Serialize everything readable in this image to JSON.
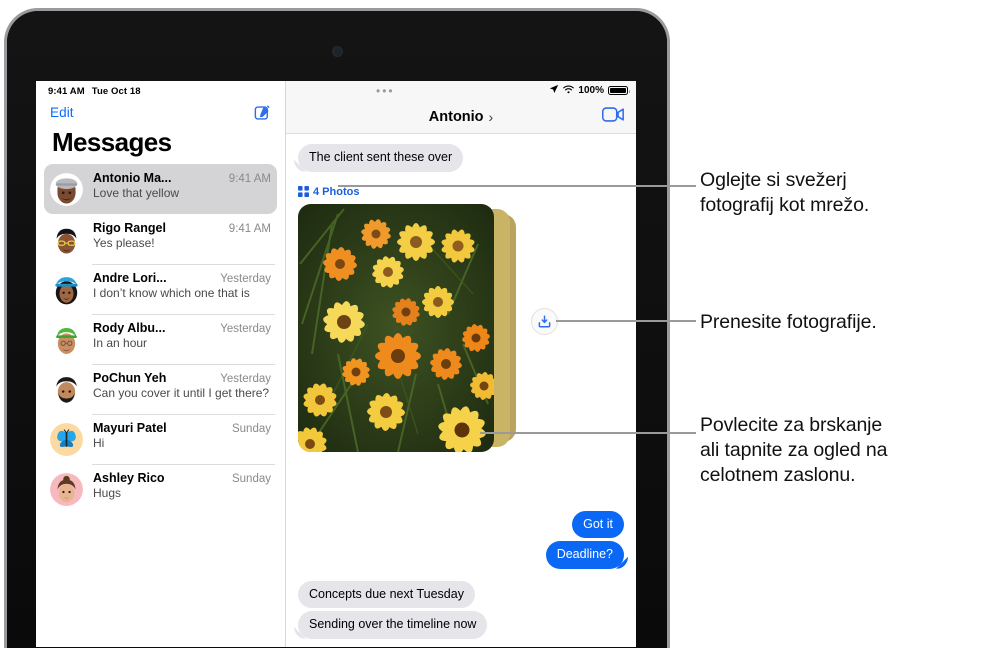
{
  "device": {
    "camera": "front-camera"
  },
  "sidebar": {
    "status_time": "9:41 AM",
    "status_date": "Tue Oct 18",
    "edit_label": "Edit",
    "compose_icon": "compose-icon",
    "title": "Messages",
    "conversations": [
      {
        "name": "Antonio Ma...",
        "time": "9:41 AM",
        "preview": "Love that yellow",
        "selected": true
      },
      {
        "name": "Rigo Rangel",
        "time": "9:41 AM",
        "preview": "Yes please!",
        "selected": false
      },
      {
        "name": "Andre Lori...",
        "time": "Yesterday",
        "preview": "I don’t know which one that is",
        "selected": false
      },
      {
        "name": "Rody Albu...",
        "time": "Yesterday",
        "preview": "In an hour",
        "selected": false
      },
      {
        "name": "PoChun Yeh",
        "time": "Yesterday",
        "preview": "Can you cover it until I get there?",
        "selected": false
      },
      {
        "name": "Mayuri Patel",
        "time": "Sunday",
        "preview": "Hi",
        "selected": false
      },
      {
        "name": "Ashley Rico",
        "time": "Sunday",
        "preview": "Hugs",
        "selected": false
      }
    ]
  },
  "conversation": {
    "grabber": "•••",
    "status": {
      "location_icon": "location-arrow-icon",
      "wifi_icon": "wifi-icon",
      "battery_percent": "100%",
      "battery_icon": "battery-full-icon"
    },
    "title": "Antonio",
    "title_chevron": "›",
    "facetime_icon": "video-camera-icon",
    "messages_top": [
      {
        "text": "The client sent these over",
        "side": "incoming",
        "tail": true
      }
    ],
    "attachment": {
      "grid_icon": "photo-grid-icon",
      "label": "4 Photos",
      "download_icon": "download-icon",
      "alt": "stack of four photos of orange and yellow daisy flowers"
    },
    "messages_bottom_right": [
      {
        "text": "Got it",
        "side": "outgoing",
        "tail": false
      },
      {
        "text": "Deadline?",
        "side": "outgoing",
        "tail": true
      }
    ],
    "messages_bottom_left": [
      {
        "text": "Concepts due next Tuesday",
        "side": "incoming",
        "tail": false
      },
      {
        "text": "Sending over the timeline now",
        "side": "incoming",
        "tail": true
      }
    ]
  },
  "callouts": [
    {
      "id": "grid-callout",
      "lines": [
        "Oglejte si svežerj",
        "fotografij kot mrežo."
      ],
      "text": "Oglejte si svežerj fotografij kot mrežo."
    },
    {
      "id": "download-callout",
      "lines": [
        "Prenesite fotografije."
      ],
      "text": "Prenesite fotografije."
    },
    {
      "id": "swipe-callout",
      "lines": [
        "Povlecite za brskanje",
        "ali tapnite za ogled na",
        "celotnem zaslonu."
      ],
      "text": "Povlecite za brskanje ali tapnite za ogled na celotnem zaslonu."
    }
  ],
  "colors": {
    "accent_blue": "#0a68f5",
    "link_blue": "#0a6cff",
    "attachment_blue": "#1a5fe0",
    "incoming_bubble": "#e5e5ea",
    "selected_row": "#d4d4d6",
    "leader_gray": "#9a9a9a"
  }
}
